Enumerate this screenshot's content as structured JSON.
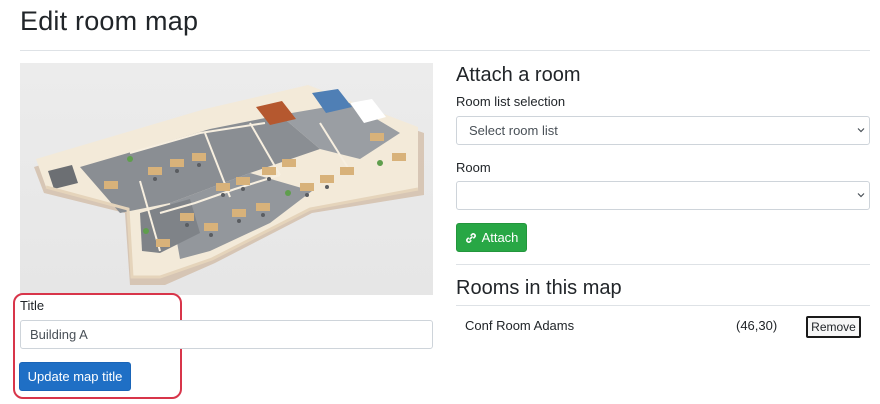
{
  "page": {
    "title": "Edit room map"
  },
  "map_image": {
    "alt": "3D office floor plan"
  },
  "title_form": {
    "label": "Title",
    "value": "Building A",
    "submit_label": "Update map title"
  },
  "attach": {
    "heading": "Attach a room",
    "room_list_label": "Room list selection",
    "room_list_selected": "Select room list",
    "room_label": "Room",
    "room_selected": "",
    "attach_label": "Attach"
  },
  "rooms": {
    "heading": "Rooms in this map",
    "items": [
      {
        "name": "Conf Room Adams",
        "coords": "(46,30)",
        "remove_label": "Remove"
      }
    ]
  },
  "colors": {
    "primary": "#1f6fc5",
    "success": "#28a745",
    "highlight": "#d8354a"
  },
  "icons": {
    "attach": "link-icon",
    "select": "chevron-down-icon"
  }
}
